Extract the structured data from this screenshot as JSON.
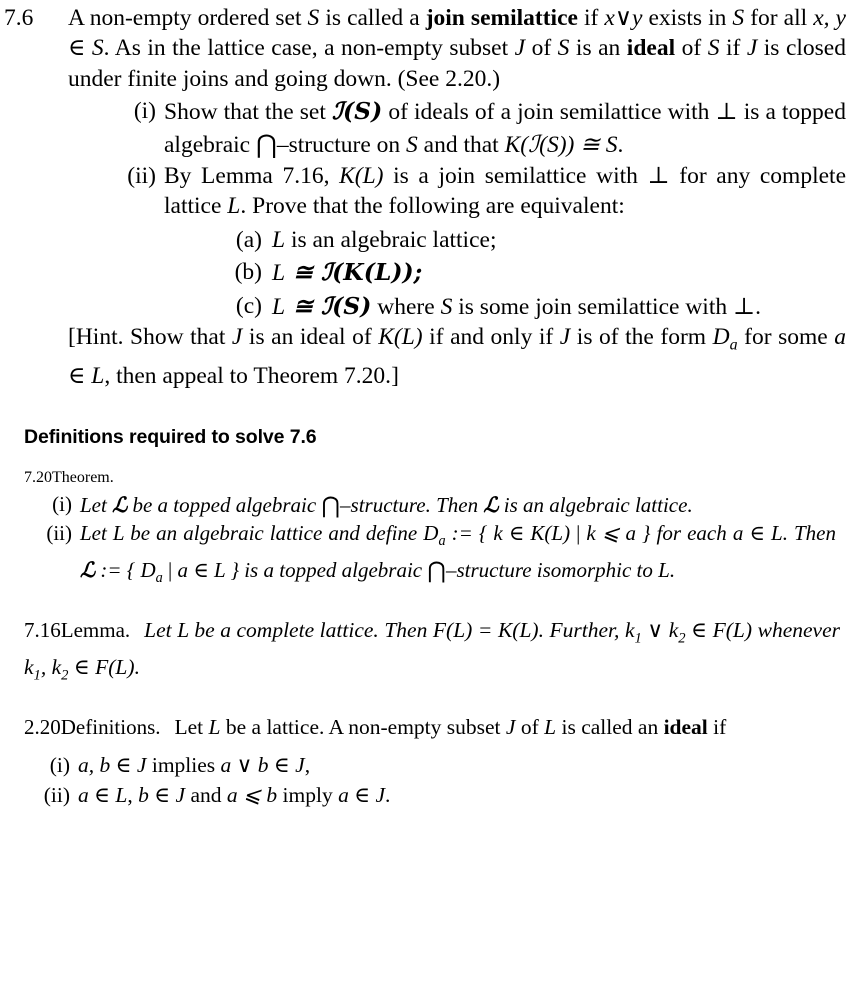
{
  "document": {
    "type": "mathematics-textbook-excerpt",
    "topic": "Join semilattices, ideals and algebraic lattices"
  },
  "exercise": {
    "number": "7.6",
    "paragraph_1": {
      "run_1": "A non-empty ordered set ",
      "var_S1": "S",
      "run_2": " is called a ",
      "bold_term": "join semilattice",
      "run_3": " if ",
      "math_xvy": "x∨y",
      "run_4": " exists in ",
      "var_S2": "S",
      "run_5": " for all ",
      "math_xy_in_S": "x, y ∈ S",
      "run_6": ". As in the lattice case, a non-empty subset ",
      "var_J": "J",
      "run_7": " of ",
      "var_S3": "S",
      "run_8": " is an ",
      "bold_term_2": "ideal",
      "run_9": " of ",
      "var_S4": "S",
      "run_10": " if ",
      "var_J2": "J",
      "run_11": " is closed under finite joins and going down. (See 2.20.)"
    },
    "items": [
      {
        "mark": "(i)",
        "run_1": "Show that the set ",
        "math_IS": "ℐ(S)",
        "run_2": " of ideals of a join semilattice with ",
        "sym_bot": "⊥",
        "run_3": " is a topped algebraic ",
        "sym_bigcap": "⋂",
        "run_4": "–structure on ",
        "var_S": "S",
        "run_5": " and that ",
        "math_KIS": "K(ℐ(S)) ≅ S",
        "run_6": "."
      },
      {
        "mark": "(ii)",
        "run_1": "By Lemma 7.16, ",
        "math_KL": "K(L)",
        "run_2": " is a join semilattice with ",
        "sym_bot": "⊥",
        "run_3": " for any complete lattice ",
        "var_L": "L",
        "run_4": ". Prove that the following are equivalent:"
      }
    ],
    "equivalents": [
      {
        "mark": "(a)",
        "var_L": "L",
        "text": " is an algebraic lattice;"
      },
      {
        "mark": "(b)",
        "var_L": "L",
        "math": " ≅ ℐ(K(L));"
      },
      {
        "mark": "(c)",
        "var_L": "L",
        "math_1": " ≅ ℐ(S)",
        "text_1": " where ",
        "var_S": "S",
        "text_2": " is some join semilattice with ",
        "sym_bot": "⊥",
        "text_3": "."
      }
    ],
    "hint": {
      "open_bracket": "[",
      "label": "Hint.",
      "run_1": " Show that ",
      "var_J": "J",
      "run_2": " is an ideal of ",
      "math_KL": "K(L)",
      "run_3": " if and only if ",
      "var_J2": "J",
      "run_4": " is of the form ",
      "math_Da": "D",
      "math_Da_sub": "a",
      "run_5": " for some ",
      "math_a_in_L": "a ∈ L",
      "run_6": ", then appeal to Theorem 7.20.",
      "close_bracket": "]"
    }
  },
  "definitions_section": {
    "heading": "Definitions required to solve 7.6"
  },
  "theorem_720": {
    "number": "7.20",
    "label": "Theorem.",
    "items": [
      {
        "mark": "(i)",
        "run_1": "Let ",
        "script_L": "ℒ",
        "run_2": " be a topped algebraic ",
        "sym_bigcap": "⋂",
        "run_3": "–structure. Then ",
        "script_L2": "ℒ",
        "run_4": " is an algebraic lattice."
      },
      {
        "mark": "(ii)",
        "run_1": "Let ",
        "var_L": "L",
        "run_2": " be an algebraic lattice and define ",
        "math_D": "D",
        "math_D_sub": "a",
        "run_3": " := { ",
        "math_k_in_KL": "k ∈ K(L)",
        "sym_mid": " | ",
        "math_k_le_a": "k ⩽ a",
        "run_4": " } for each ",
        "math_a_in_L": "a ∈ L",
        "run_5": ". Then ",
        "script_L": "ℒ",
        "run_6": " := { ",
        "math_Da": "D",
        "math_Da_sub": "a",
        "sym_mid2": " | ",
        "math_a_in_L2": "a ∈ L",
        "run_7": " } is a topped algebraic ",
        "sym_bigcap": "⋂",
        "run_8": "–structure isomorphic to ",
        "var_L2": "L",
        "run_9": "."
      }
    ]
  },
  "lemma_716": {
    "number": "7.16",
    "label": "Lemma.",
    "run_1": "Let ",
    "var_L": "L",
    "run_2": " be a complete lattice. Then ",
    "math_FL_eq_KL": "F(L) = K(L)",
    "run_3": ". Further, ",
    "math_k1_vee_k2": "k",
    "math_k1_sub": "1",
    "math_vee": " ∨ ",
    "math_k2": "k",
    "math_k2_sub": "2",
    "run_4": " ∈ ",
    "math_FL": "F(L)",
    "run_5": " whenever ",
    "math_k1b": "k",
    "math_k1b_sub": "1",
    "math_comma": ", ",
    "math_k2b": "k",
    "math_k2b_sub": "2",
    "run_6": " ∈ ",
    "math_FL2": "F(L)",
    "run_7": "."
  },
  "definitions_220": {
    "number": "2.20",
    "label": "Definitions.",
    "run_1": "Let ",
    "var_L": "L",
    "run_2": " be a lattice. A non-empty subset ",
    "var_J": "J",
    "run_3": " of ",
    "var_L2": "L",
    "run_4": " is called an ",
    "bold_term": "ideal",
    "run_5": " if",
    "items": [
      {
        "mark": "(i)",
        "math_ab_in_J": "a, b ∈ J",
        "text_1": " implies ",
        "math_avb_in_J": "a ∨ b ∈ J",
        "text_2": ","
      },
      {
        "mark": "(ii)",
        "math_a_in_L": "a ∈ L",
        "text_1": ", ",
        "math_b_in_J": "b ∈ J",
        "text_2": " and ",
        "math_a_le_b": "a ⩽ b",
        "text_3": " imply ",
        "math_a_in_J": "a ∈ J",
        "text_4": "."
      }
    ]
  },
  "colors": {
    "text": "#000000",
    "background": "#ffffff"
  }
}
